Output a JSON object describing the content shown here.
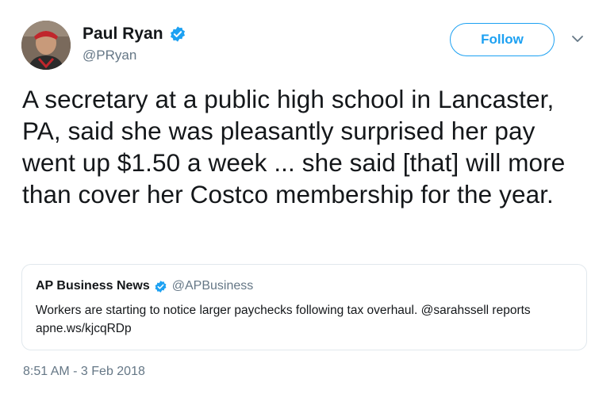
{
  "author": {
    "name": "Paul Ryan",
    "handle": "@PRyan",
    "verified": true,
    "avatar_icon": "profile-photo"
  },
  "header": {
    "follow_label": "Follow",
    "menu_icon": "chevron-down-icon"
  },
  "tweet": {
    "text": "A secretary at a public high school in Lancaster, PA, said she was pleasantly surprised her pay went up $1.50 a week ... she said [that] will more than cover her Costco membership for the year.",
    "timestamp": "8:51 AM - 3 Feb 2018"
  },
  "quoted_tweet": {
    "name": "AP Business News",
    "handle": "@APBusiness",
    "verified": true,
    "text": "Workers are starting to notice larger paychecks following tax overhaul. @sarahssell reports apne.ws/kjcqRDp"
  },
  "colors": {
    "accent": "#1da1f2",
    "text": "#14171a",
    "secondary_text": "#657786",
    "border": "#e1e8ed"
  }
}
